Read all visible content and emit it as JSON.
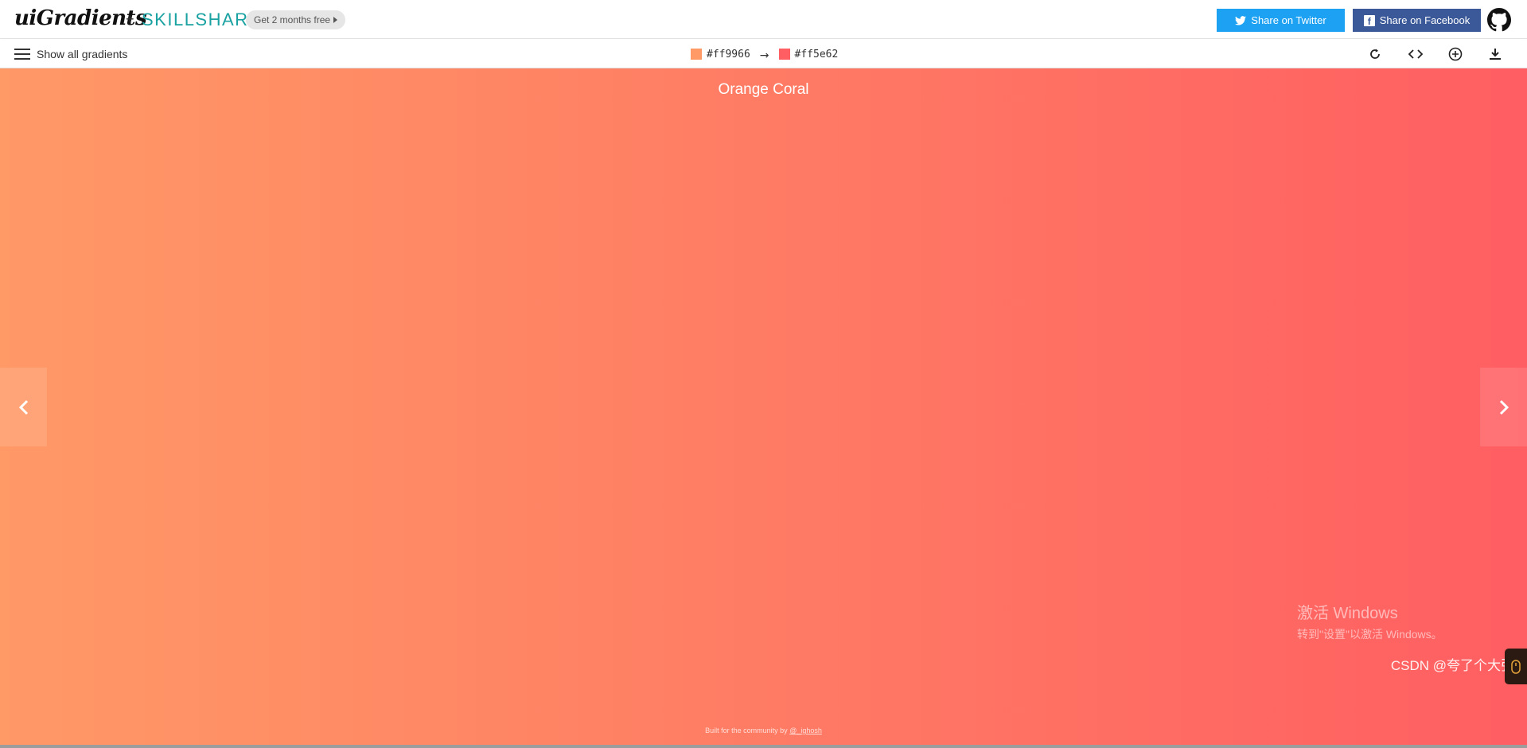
{
  "header": {
    "logo_text": "uiGradients",
    "plus": "+",
    "partner": "SKILLSHARE",
    "promo": "Get 2 months free",
    "share_twitter": "Share on Twitter",
    "share_facebook": "Share on Facebook",
    "facebook_glyph": "f"
  },
  "toolbar": {
    "menu_label": "Show all gradients",
    "color_start": "#ff9966",
    "arrow": "→",
    "color_end": "#ff5e62",
    "icons": [
      "rotate-icon",
      "code-icon",
      "add-icon",
      "download-icon"
    ]
  },
  "gradient": {
    "name": "Orange Coral",
    "colors": [
      "#ff9966",
      "#ff5e62"
    ],
    "direction": "to right"
  },
  "footer": {
    "credit": "Built for the community by",
    "handle": "@_ighosh"
  },
  "watermark": {
    "title": "激活 Windows",
    "subtitle": "转到\"设置\"以激活 Windows。"
  },
  "csdn": "CSDN @夸了个大张",
  "colors": {
    "twitter": "#1da1f2",
    "facebook": "#3b5998",
    "skillshare": "#1aa1a1"
  }
}
